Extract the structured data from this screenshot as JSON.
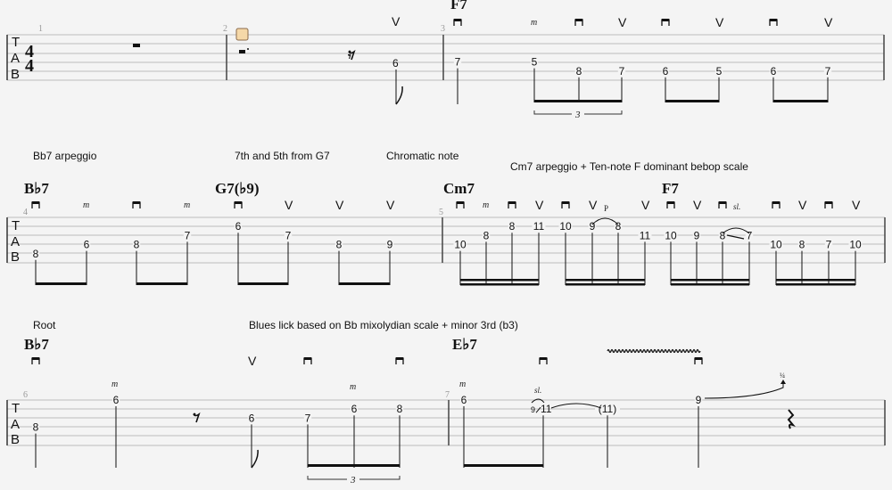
{
  "score": {
    "time_signature": {
      "top": "4",
      "bottom": "4"
    },
    "tab_letters": [
      "T",
      "A",
      "B"
    ],
    "rows": [
      {
        "annotations": [],
        "measures": [
          {
            "number": "1",
            "chord": "",
            "events": [
              {
                "type": "rest",
                "kind": "whole"
              }
            ]
          },
          {
            "number": "2",
            "chord": "",
            "marker": "section-marker",
            "events": [
              {
                "type": "rest",
                "kind": "dotted-half"
              },
              {
                "type": "rest",
                "kind": "eighth"
              },
              {
                "type": "note",
                "fret": "6",
                "string": 4,
                "stroke": "up",
                "flag": "eighth"
              }
            ]
          },
          {
            "number": "3",
            "chord": "F7",
            "events": [
              {
                "type": "note",
                "fret": "7",
                "string": 4,
                "stroke": "down",
                "stem": "quarter"
              },
              {
                "type": "note",
                "fret": "5",
                "string": 4,
                "stroke": "m",
                "group": "triplet"
              },
              {
                "type": "note",
                "fret": "8",
                "string": 5,
                "stroke": "down",
                "group": "triplet"
              },
              {
                "type": "note",
                "fret": "7",
                "string": 5,
                "stroke": "up",
                "group": "triplet"
              },
              {
                "type": "note",
                "fret": "6",
                "string": 5,
                "stroke": "down"
              },
              {
                "type": "note",
                "fret": "5",
                "string": 5,
                "stroke": "up"
              },
              {
                "type": "note",
                "fret": "6",
                "string": 5,
                "stroke": "down"
              },
              {
                "type": "note",
                "fret": "7",
                "string": 5,
                "stroke": "up"
              }
            ],
            "tuplet": "3"
          }
        ]
      },
      {
        "annotations": [
          "Bb7 arpeggio",
          "7th and 5th from G7",
          "Chromatic note",
          "Cm7 arpeggio + Ten-note F dominant bebop scale"
        ],
        "measures": [
          {
            "number": "4",
            "chords": [
              "B♭7",
              "G7(♭9)"
            ],
            "events": [
              {
                "type": "note",
                "fret": "8",
                "string": 5,
                "stroke": "down"
              },
              {
                "type": "note",
                "fret": "6",
                "string": 4,
                "stroke": "m"
              },
              {
                "type": "note",
                "fret": "8",
                "string": 4,
                "stroke": "down"
              },
              {
                "type": "note",
                "fret": "7",
                "string": 3,
                "stroke": "m"
              },
              {
                "type": "note",
                "fret": "6",
                "string": 2,
                "stroke": "down"
              },
              {
                "type": "note",
                "fret": "7",
                "string": 3,
                "stroke": "up"
              },
              {
                "type": "note",
                "fret": "8",
                "string": 4,
                "stroke": "up"
              },
              {
                "type": "note",
                "fret": "9",
                "string": 4,
                "stroke": "up"
              }
            ]
          },
          {
            "number": "5",
            "chords": [
              "Cm7",
              "F7"
            ],
            "events": [
              {
                "type": "note",
                "fret": "10",
                "string": 4,
                "stroke": "down"
              },
              {
                "type": "note",
                "fret": "8",
                "string": 3,
                "stroke": "m"
              },
              {
                "type": "note",
                "fret": "8",
                "string": 2,
                "stroke": "down"
              },
              {
                "type": "note",
                "fret": "11",
                "string": 2,
                "stroke": "up"
              },
              {
                "type": "note",
                "fret": "10",
                "string": 2,
                "stroke": "down"
              },
              {
                "type": "note",
                "fret": "9",
                "string": 2,
                "stroke": "up",
                "technique": "P"
              },
              {
                "type": "note",
                "fret": "8",
                "string": 2,
                "stroke": ""
              },
              {
                "type": "note",
                "fret": "11",
                "string": 3,
                "stroke": "up"
              },
              {
                "type": "note",
                "fret": "10",
                "string": 3,
                "stroke": "down"
              },
              {
                "type": "note",
                "fret": "9",
                "string": 3,
                "stroke": "up"
              },
              {
                "type": "note",
                "fret": "8",
                "string": 3,
                "stroke": "down",
                "technique": "sl."
              },
              {
                "type": "note",
                "fret": "7",
                "string": 3,
                "stroke": ""
              },
              {
                "type": "note",
                "fret": "10",
                "string": 4,
                "stroke": "down"
              },
              {
                "type": "note",
                "fret": "8",
                "string": 4,
                "stroke": "up"
              },
              {
                "type": "note",
                "fret": "7",
                "string": 4,
                "stroke": "down"
              },
              {
                "type": "note",
                "fret": "10",
                "string": 4,
                "stroke": "up"
              }
            ]
          }
        ]
      },
      {
        "annotations": [
          "Root",
          "Blues lick based on Bb mixolydian scale + minor 3rd (b3)"
        ],
        "measures": [
          {
            "number": "6",
            "chord": "B♭7",
            "events": [
              {
                "type": "note",
                "fret": "8",
                "string": 4,
                "stroke": "down"
              },
              {
                "type": "note",
                "fret": "6",
                "string": 1,
                "stroke": "m"
              },
              {
                "type": "rest",
                "kind": "eighth"
              },
              {
                "type": "note",
                "fret": "6",
                "string": 3,
                "stroke": "up",
                "flag": "eighth"
              },
              {
                "type": "note",
                "fret": "7",
                "string": 3,
                "stroke": "down",
                "group": "triplet"
              },
              {
                "type": "note",
                "fret": "6",
                "string": 2,
                "stroke": "m",
                "group": "triplet"
              },
              {
                "type": "note",
                "fret": "8",
                "string": 2,
                "stroke": "down",
                "group": "triplet"
              }
            ],
            "tuplet": "3"
          },
          {
            "number": "7",
            "chord": "E♭7",
            "events": [
              {
                "type": "note",
                "fret": "6",
                "string": 1,
                "stroke": "m"
              },
              {
                "type": "note",
                "fret": "9☆11",
                "grace": "9",
                "main": "11",
                "string": 2,
                "stroke": "down",
                "technique": "sl."
              },
              {
                "type": "note",
                "fret": "(11)",
                "string": 2,
                "stroke": "",
                "tied": true
              },
              {
                "type": "note",
                "fret": "9",
                "string": 1,
                "stroke": "down",
                "technique": "vibrato",
                "bend": "¼"
              },
              {
                "type": "rest",
                "kind": "quarter"
              }
            ]
          }
        ]
      }
    ]
  }
}
